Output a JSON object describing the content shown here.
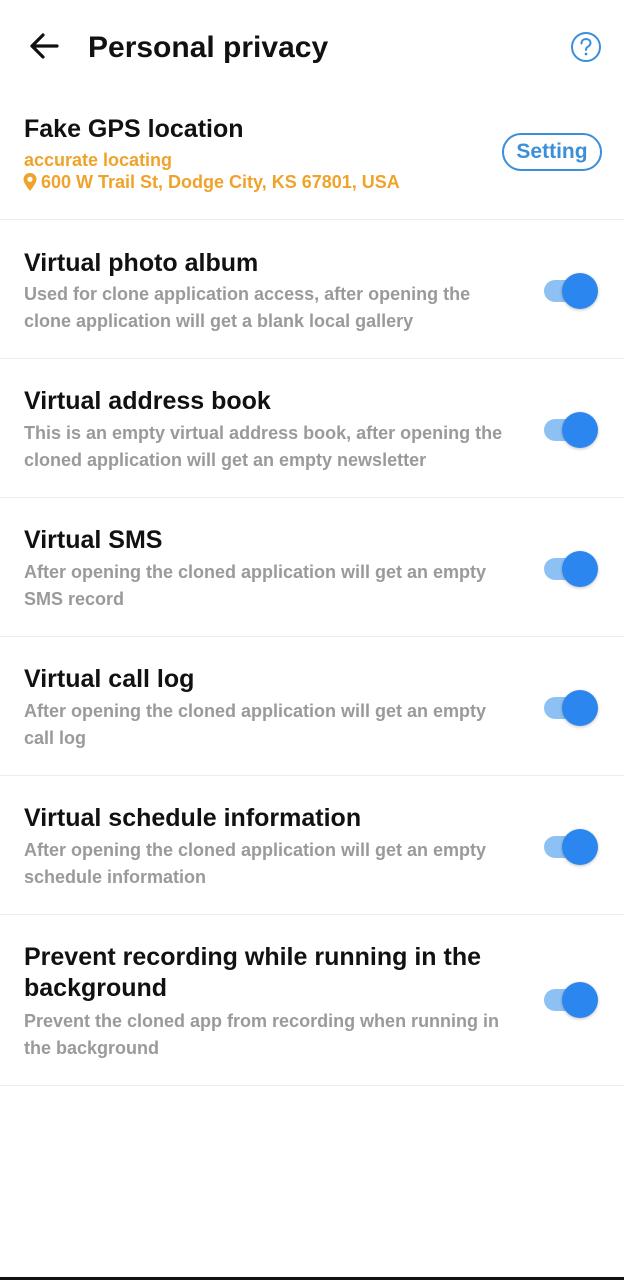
{
  "header": {
    "title": "Personal privacy",
    "back_icon": "arrow-left-icon",
    "help_icon": "question-circle-icon"
  },
  "gps": {
    "title": "Fake GPS location",
    "mode": "accurate locating",
    "address": "600 W Trail St, Dodge City, KS 67801, USA",
    "pin_icon": "location-pin-icon",
    "setting_label": "Setting"
  },
  "toggles": [
    {
      "title": "Virtual photo album",
      "description": "Used for clone application access, after opening the clone application will get a blank local gallery",
      "enabled": true
    },
    {
      "title": "Virtual address book",
      "description": "This is an empty virtual address book, after opening the cloned application will get an empty newsletter",
      "enabled": true
    },
    {
      "title": "Virtual SMS",
      "description": "After opening the cloned application will get an empty SMS record",
      "enabled": true
    },
    {
      "title": "Virtual call log",
      "description": "After opening the cloned application will get an empty call log",
      "enabled": true
    },
    {
      "title": "Virtual schedule information",
      "description": "After opening the cloned application will get an empty schedule information",
      "enabled": true
    },
    {
      "title": "Prevent recording while running in the background",
      "description": "Prevent the cloned app from recording when running in the background",
      "enabled": true
    }
  ],
  "colors": {
    "accent_blue": "#2b86ef",
    "accent_blue_light": "#8ec1f3",
    "outline_blue": "#3b8fd9",
    "gps_orange": "#f0a32a",
    "description_gray": "#9a9a9a"
  }
}
